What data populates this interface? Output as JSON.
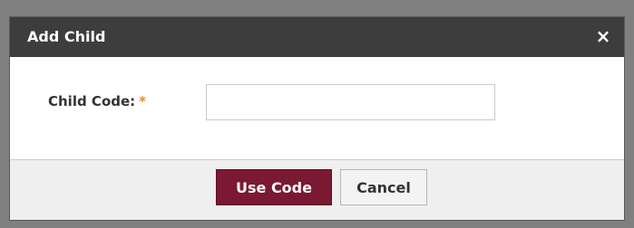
{
  "dialog": {
    "title": "Add Child",
    "close_symbol": "×"
  },
  "form": {
    "child_code_label": "Child Code:",
    "required_marker": "*",
    "child_code_value": "",
    "child_code_placeholder": ""
  },
  "buttons": {
    "use_code": "Use Code",
    "cancel": "Cancel"
  },
  "colors": {
    "titlebar": "#3d3d3d",
    "primary_button": "#7a1931",
    "required_marker": "#e58a2b"
  },
  "icons": {
    "close": "close-icon"
  }
}
